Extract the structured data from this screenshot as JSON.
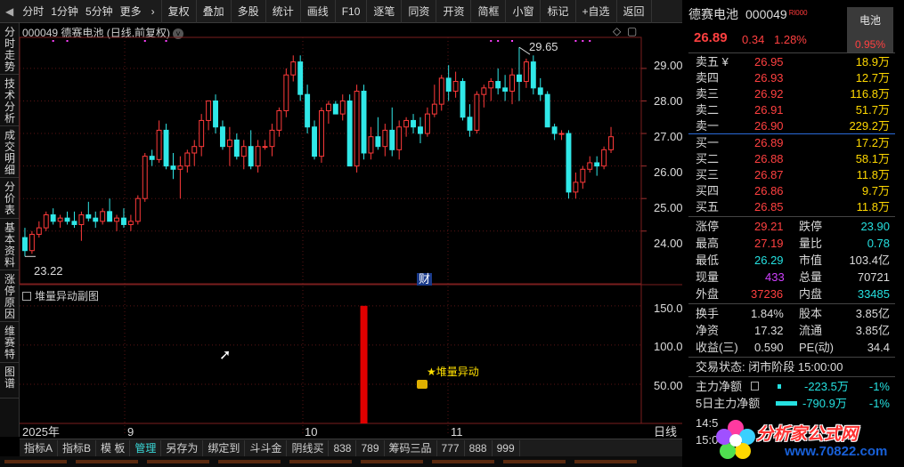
{
  "toolbar": {
    "items": [
      "分时",
      "1分钟",
      "5分钟",
      "更多"
    ],
    "more_arrow": "›",
    "buttons": [
      "复权",
      "叠加",
      "多股",
      "统计",
      "画线",
      "F10",
      "逐笔",
      "同资",
      "开资",
      "简框",
      "小窗",
      "标记",
      "+自选",
      "返回"
    ]
  },
  "left_tabs": [
    "分时走势",
    "技术分析",
    "成交明细",
    "分价表",
    "基本资料",
    "涨停原因",
    "维赛特",
    "图谱"
  ],
  "chart": {
    "title": "000049 德赛电池 (日线,前复权)",
    "high_label": "29.65",
    "low_label": "23.22",
    "price_axis": [
      "29.00",
      "28.00",
      "27.00",
      "26.00",
      "25.00",
      "24.00"
    ],
    "cai_label": "财",
    "sub_title": "堆量异动副图",
    "sub_axis": [
      "150.0",
      "100.0",
      "50.00"
    ],
    "sub_annotation": "★堆量异动",
    "date_labels": [
      "2025年",
      "9",
      "10",
      "11"
    ],
    "period_label": "日线"
  },
  "chart_data": {
    "type": "candlestick",
    "ohlc": [
      [
        23.8,
        24.1,
        23.22,
        23.4
      ],
      [
        23.4,
        24.0,
        23.3,
        23.9
      ],
      [
        23.9,
        24.3,
        23.8,
        24.1
      ],
      [
        24.1,
        24.6,
        24.0,
        24.5
      ],
      [
        24.5,
        24.7,
        24.2,
        24.3
      ],
      [
        24.3,
        24.5,
        24.1,
        24.4
      ],
      [
        24.4,
        24.6,
        24.2,
        24.3
      ],
      [
        24.3,
        24.6,
        24.1,
        24.2
      ],
      [
        24.2,
        24.6,
        23.7,
        24.5
      ],
      [
        24.5,
        24.9,
        24.3,
        24.4
      ],
      [
        24.4,
        24.6,
        24.1,
        24.3
      ],
      [
        24.3,
        24.7,
        24.2,
        24.6
      ],
      [
        24.6,
        25.0,
        24.4,
        24.3
      ],
      [
        24.3,
        24.5,
        24.0,
        24.4
      ],
      [
        24.4,
        24.7,
        24.1,
        24.2
      ],
      [
        24.2,
        24.5,
        24.0,
        24.3
      ],
      [
        24.3,
        25.1,
        24.2,
        25.0
      ],
      [
        25.0,
        26.4,
        24.9,
        26.3
      ],
      [
        26.3,
        26.5,
        26.0,
        26.2
      ],
      [
        26.2,
        27.4,
        26.1,
        27.1
      ],
      [
        27.1,
        27.3,
        25.9,
        26.0
      ],
      [
        26.0,
        26.4,
        25.6,
        25.9
      ],
      [
        25.9,
        26.3,
        25.0,
        26.0
      ],
      [
        26.0,
        26.5,
        25.8,
        26.4
      ],
      [
        26.4,
        26.8,
        26.0,
        26.6
      ],
      [
        26.6,
        27.6,
        26.3,
        27.4
      ],
      [
        27.4,
        28.0,
        27.1,
        28.0
      ],
      [
        28.0,
        28.2,
        27.0,
        27.2
      ],
      [
        27.2,
        27.4,
        26.5,
        26.6
      ],
      [
        26.6,
        27.2,
        26.0,
        26.8
      ],
      [
        26.8,
        27.0,
        26.2,
        26.3
      ],
      [
        26.3,
        26.8,
        25.9,
        26.6
      ],
      [
        26.6,
        27.1,
        25.9,
        26.0
      ],
      [
        26.0,
        26.8,
        25.8,
        26.6
      ],
      [
        26.6,
        26.8,
        26.5,
        26.6
      ],
      [
        26.6,
        27.3,
        26.3,
        27.1
      ],
      [
        27.1,
        27.8,
        26.9,
        27.7
      ],
      [
        27.7,
        29.0,
        27.5,
        28.8
      ],
      [
        28.8,
        29.4,
        28.6,
        29.2
      ],
      [
        29.2,
        29.4,
        28.0,
        28.2
      ],
      [
        28.2,
        28.5,
        27.0,
        27.2
      ],
      [
        27.2,
        27.4,
        26.2,
        26.3
      ],
      [
        26.3,
        27.8,
        26.1,
        27.7
      ],
      [
        27.7,
        28.0,
        27.3,
        27.9
      ],
      [
        27.9,
        28.0,
        27.6,
        27.6
      ],
      [
        27.6,
        28.2,
        27.4,
        28.0
      ],
      [
        28.0,
        28.2,
        26.9,
        26.0
      ],
      [
        26.0,
        28.5,
        25.8,
        28.3
      ],
      [
        28.3,
        28.5,
        26.2,
        26.4
      ],
      [
        26.4,
        27.2,
        26.2,
        26.9
      ],
      [
        26.9,
        27.5,
        26.5,
        26.6
      ],
      [
        26.6,
        27.3,
        26.3,
        27.1
      ],
      [
        27.1,
        27.8,
        26.3,
        26.5
      ],
      [
        26.5,
        27.4,
        26.2,
        27.2
      ],
      [
        27.2,
        27.5,
        26.9,
        27.4
      ],
      [
        27.4,
        27.6,
        27.0,
        27.2
      ],
      [
        27.2,
        27.5,
        26.7,
        27.0
      ],
      [
        27.0,
        27.8,
        26.9,
        27.6
      ],
      [
        27.6,
        28.5,
        27.5,
        27.9
      ],
      [
        27.9,
        28.8,
        27.7,
        28.7
      ],
      [
        28.7,
        29.1,
        28.0,
        28.3
      ],
      [
        28.3,
        28.9,
        28.1,
        28.6
      ],
      [
        28.6,
        28.7,
        27.4,
        27.5
      ],
      [
        27.5,
        27.9,
        26.9,
        27.1
      ],
      [
        27.1,
        28.3,
        27.0,
        28.2
      ],
      [
        28.2,
        28.5,
        27.8,
        28.4
      ],
      [
        28.4,
        28.7,
        28.0,
        28.6
      ],
      [
        28.6,
        29.0,
        28.2,
        28.4
      ],
      [
        28.4,
        28.8,
        28.0,
        28.3
      ],
      [
        28.3,
        29.0,
        27.9,
        28.8
      ],
      [
        28.8,
        29.65,
        28.0,
        28.6
      ],
      [
        28.6,
        29.3,
        28.4,
        29.2
      ],
      [
        29.2,
        29.4,
        28.2,
        28.4
      ],
      [
        28.4,
        28.7,
        28.0,
        28.2
      ],
      [
        28.2,
        28.3,
        27.2,
        27.2
      ],
      [
        27.2,
        27.3,
        26.8,
        27.0
      ],
      [
        27.0,
        27.1,
        26.8,
        27.0
      ],
      [
        27.0,
        27.1,
        25.0,
        25.2
      ],
      [
        25.2,
        25.8,
        25.0,
        25.5
      ],
      [
        25.5,
        26.0,
        25.3,
        25.9
      ],
      [
        25.9,
        26.3,
        25.8,
        26.1
      ],
      [
        26.1,
        26.3,
        25.7,
        26.0
      ],
      [
        26.0,
        26.6,
        25.9,
        26.5
      ],
      [
        26.5,
        27.2,
        26.4,
        26.9
      ]
    ],
    "sub_series": {
      "name": "堆量异动",
      "bar_index": 48,
      "value": 150
    },
    "ylim": [
      22.9,
      29.9
    ],
    "sub_ylim": [
      0,
      160
    ]
  },
  "bottom_tabs": [
    "指标A",
    "指标B",
    "模 板",
    "管理",
    "另存为",
    "绑定到",
    "斗斗金",
    "阴线买",
    "838",
    "789",
    "筹码三品",
    "777",
    "888",
    "999"
  ],
  "active_bottom_tab": "管理",
  "quote": {
    "name": "德赛电池",
    "code": "000049",
    "sup": "Rl000",
    "sector_name": "电池",
    "sector_pct": "0.95%",
    "price": "26.89",
    "change": "0.34",
    "change_pct": "1.28%",
    "asks": [
      {
        "label": "卖五 ¥",
        "price": "26.95",
        "vol": "18.9万"
      },
      {
        "label": "卖四",
        "price": "26.93",
        "vol": "12.7万"
      },
      {
        "label": "卖三",
        "price": "26.92",
        "vol": "116.8万"
      },
      {
        "label": "卖二",
        "price": "26.91",
        "vol": "51.7万"
      },
      {
        "label": "卖一",
        "price": "26.90",
        "vol": "229.2万"
      }
    ],
    "bids": [
      {
        "label": "买一",
        "price": "26.89",
        "vol": "17.2万"
      },
      {
        "label": "买二",
        "price": "26.88",
        "vol": "58.1万"
      },
      {
        "label": "买三",
        "price": "26.87",
        "vol": "11.8万"
      },
      {
        "label": "买四",
        "price": "26.86",
        "vol": "9.7万"
      },
      {
        "label": "买五",
        "price": "26.85",
        "vol": "11.8万"
      }
    ],
    "stats": {
      "zt_l": "涨停",
      "zt": "29.21",
      "dt_l": "跌停",
      "dt": "23.90",
      "hi_l": "最高",
      "hi": "27.19",
      "lb_l": "量比",
      "lb": "0.78",
      "lo_l": "最低",
      "lo": "26.29",
      "sz_l": "市值",
      "sz": "103.4亿",
      "xl_l": "现量",
      "xl": "433",
      "zl_l": "总量",
      "zl": "70721",
      "wp_l": "外盘",
      "wp": "37236",
      "np_l": "内盘",
      "np": "33485"
    },
    "fund": {
      "hs_l": "换手",
      "hs": "1.84%",
      "gb_l": "股本",
      "gb": "3.85亿",
      "jz_l": "净资",
      "jz": "17.32",
      "lt_l": "流通",
      "lt": "3.85亿",
      "sy_l": "收益(三)",
      "sy": "0.590",
      "pe_l": "PE(动)",
      "pe": "34.4"
    },
    "status": "交易状态: 闭市阶段 15:00:00",
    "flow": [
      {
        "label": "主力净额",
        "value": "-223.5万",
        "pct": "-1%"
      },
      {
        "label": "5日主力净额",
        "value": "-790.9万",
        "pct": "-1%"
      }
    ],
    "times": [
      "14:5",
      "15:0"
    ]
  },
  "logo": {
    "text": "分析家公式网",
    "url": "www.70822.com"
  }
}
